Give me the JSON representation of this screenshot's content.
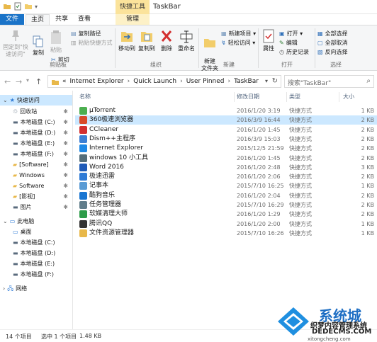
{
  "window": {
    "title": "TaskBar",
    "context_tab_group": "快捷工具"
  },
  "ribbon_tabs": [
    "文件",
    "主页",
    "共享",
    "查看",
    "管理"
  ],
  "ribbon": {
    "clipboard": {
      "pin_quick_access": "固定到\"快速访问\"",
      "copy": "复制",
      "paste": "粘贴",
      "cut": "剪切",
      "copy_path": "复制路径",
      "paste_shortcut": "粘贴快捷方式",
      "group": "剪贴板"
    },
    "organize": {
      "move_to": "移动到",
      "copy_to": "复制到",
      "delete": "删除",
      "rename": "重命名",
      "group": "组织"
    },
    "new": {
      "new_folder": "新建\n文件夹",
      "new_item": "新建项目 ▾",
      "easy_access": "轻松访问 ▾",
      "group": "新建"
    },
    "open": {
      "properties": "属性",
      "open": "打开 ▾",
      "edit": "编辑",
      "history": "历史记录",
      "group": "打开"
    },
    "select": {
      "select_all": "全部选择",
      "select_none": "全部取消",
      "invert": "反向选择",
      "group": "选择"
    }
  },
  "address": {
    "crumbs": [
      "Internet Explorer",
      "Quick Launch",
      "User Pinned",
      "TaskBar"
    ],
    "prefix": "«",
    "search_placeholder": "搜索\"TaskBar\""
  },
  "nav": {
    "quick_access": "快速访问",
    "items": [
      {
        "label": "回收站",
        "pinned": true
      },
      {
        "label": "本地磁盘 (C:)",
        "pinned": true
      },
      {
        "label": "本地磁盘 (D:)",
        "pinned": true
      },
      {
        "label": "本地磁盘 (E:)",
        "pinned": true
      },
      {
        "label": "本地磁盘 (F:)",
        "pinned": true
      },
      {
        "label": "[Software]",
        "pinned": true
      },
      {
        "label": "Windows",
        "pinned": true
      },
      {
        "label": "Software",
        "pinned": true
      },
      {
        "label": "[影视]",
        "pinned": true
      },
      {
        "label": "图片",
        "pinned": true
      }
    ],
    "this_pc": "此电脑",
    "pc_items": [
      "桌面",
      "本地磁盘 (C:)",
      "本地磁盘 (D:)",
      "本地磁盘 (E:)",
      "本地磁盘 (F:)"
    ],
    "network": "网络"
  },
  "columns": {
    "name": "名称",
    "date": "修改日期",
    "type": "类型",
    "size": "大小"
  },
  "files": [
    {
      "name": "µTorrent",
      "date": "2016/1/20 3:19",
      "type": "快捷方式",
      "size": "1 KB",
      "color": "#4caf50"
    },
    {
      "name": "360极速浏览器",
      "date": "2016/3/9 16:44",
      "type": "快捷方式",
      "size": "2 KB",
      "color": "#d84a2a",
      "selected": true
    },
    {
      "name": "CCleaner",
      "date": "2016/1/20 1:45",
      "type": "快捷方式",
      "size": "2 KB",
      "color": "#d32f2f"
    },
    {
      "name": "Dism++主程序",
      "date": "2016/3/9 15:03",
      "type": "快捷方式",
      "size": "2 KB",
      "color": "#3b7fd4"
    },
    {
      "name": "Internet Explorer",
      "date": "2015/12/5 21:59",
      "type": "快捷方式",
      "size": "2 KB",
      "color": "#1e88e5"
    },
    {
      "name": "windows 10 小工具",
      "date": "2016/1/20 1:45",
      "type": "快捷方式",
      "size": "2 KB",
      "color": "#546e7a"
    },
    {
      "name": "Word 2016",
      "date": "2016/1/20 2:48",
      "type": "快捷方式",
      "size": "3 KB",
      "color": "#1e5bb8"
    },
    {
      "name": "极速迅雷",
      "date": "2016/1/20 2:06",
      "type": "快捷方式",
      "size": "2 KB",
      "color": "#2f7bd6"
    },
    {
      "name": "记事本",
      "date": "2015/7/10 16:25",
      "type": "快捷方式",
      "size": "1 KB",
      "color": "#5a9bd5"
    },
    {
      "name": "酷狗音乐",
      "date": "2016/1/20 2:04",
      "type": "快捷方式",
      "size": "2 KB",
      "color": "#1976d2"
    },
    {
      "name": "任务管理器",
      "date": "2015/7/10 16:29",
      "type": "快捷方式",
      "size": "2 KB",
      "color": "#607d8b"
    },
    {
      "name": "软媒清理大师",
      "date": "2016/1/20 1:29",
      "type": "快捷方式",
      "size": "2 KB",
      "color": "#2e9c4a"
    },
    {
      "name": "腾讯QQ",
      "date": "2016/1/20 2:00",
      "type": "快捷方式",
      "size": "1 KB",
      "color": "#333333"
    },
    {
      "name": "文件资源管理器",
      "date": "2015/7/10 16:26",
      "type": "快捷方式",
      "size": "1 KB",
      "color": "#e8b84a"
    }
  ],
  "status": {
    "count": "14 个项目",
    "selected": "选中 1 个项目",
    "size": "1.48 KB"
  },
  "watermark": {
    "title": "系统城",
    "subtitle": "织梦内容管理系统",
    "url": "DEDECMS.COM",
    "url2": "xitongcheng.com"
  }
}
